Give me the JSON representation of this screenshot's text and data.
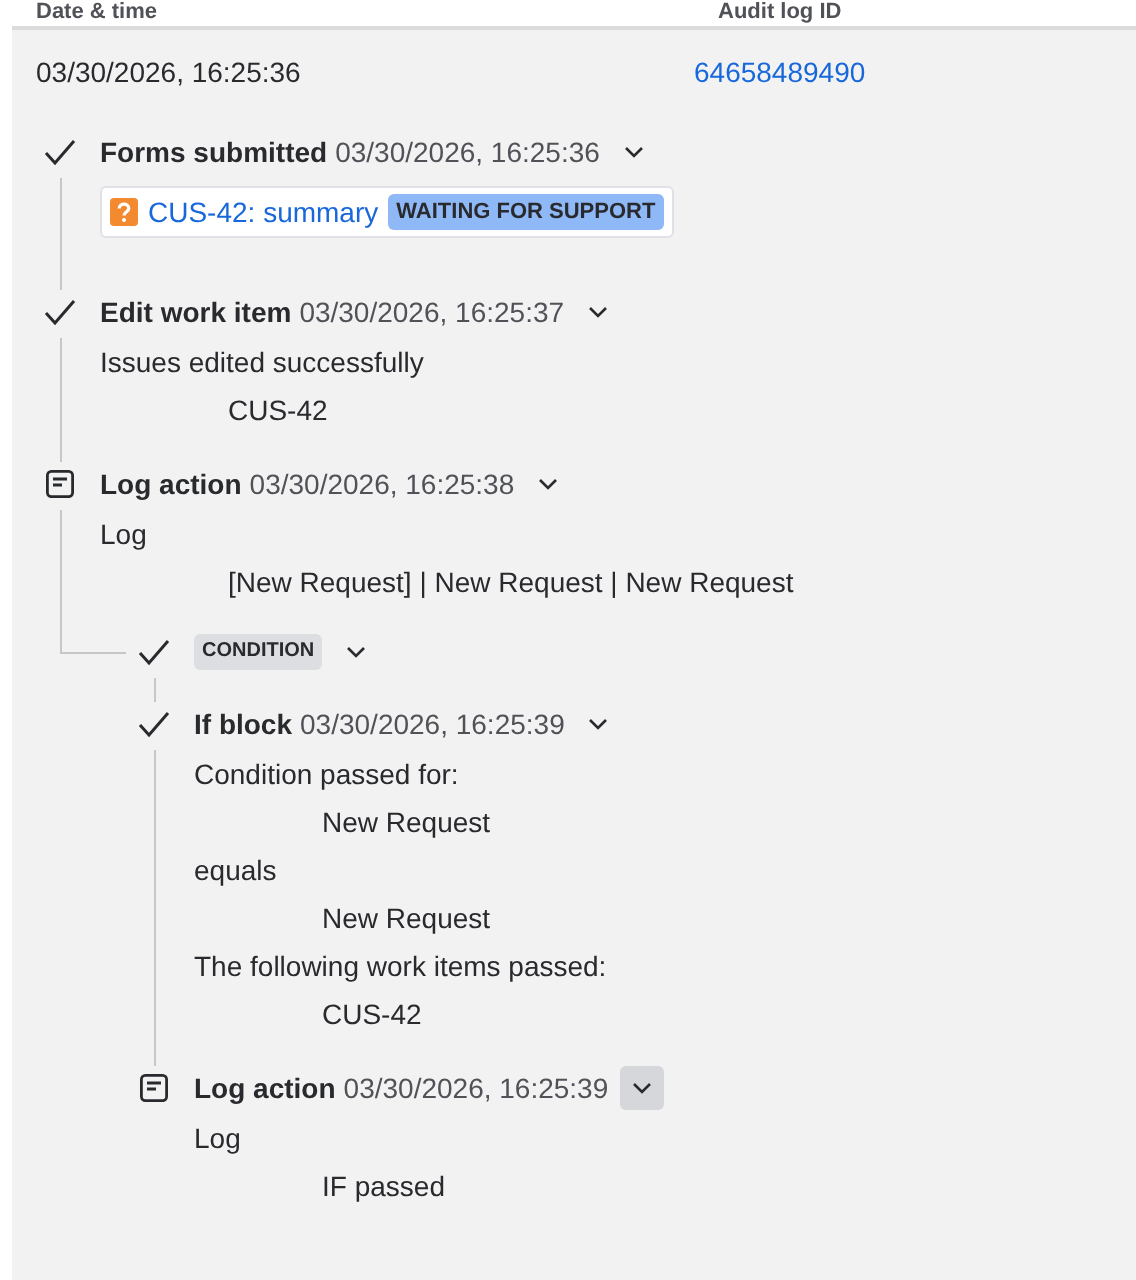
{
  "table": {
    "columns": [
      "Date & time",
      "Audit log ID"
    ],
    "row": {
      "date": "03/30/2026, 16:25:36",
      "audit_id": "64658489490"
    }
  },
  "steps": [
    {
      "kind": "check",
      "title": "Forms submitted",
      "time": "03/30/2026, 16:25:36",
      "chevron_highlighted": false,
      "issue": {
        "key": "CUS-42: summary",
        "status": "WAITING FOR SUPPORT"
      }
    },
    {
      "kind": "check",
      "title": "Edit work item",
      "time": "03/30/2026, 16:25:37",
      "chevron_highlighted": false,
      "lines": [
        {
          "kind": "label",
          "text": "Issues edited successfully"
        },
        {
          "kind": "value",
          "text": "CUS-42"
        }
      ]
    },
    {
      "kind": "log",
      "title": "Log action",
      "time": "03/30/2026, 16:25:38",
      "chevron_highlighted": false,
      "lines": [
        {
          "kind": "label",
          "text": "Log"
        },
        {
          "kind": "value",
          "text": "[New Request] | New Request | New Request"
        }
      ],
      "children": [
        {
          "kind": "condition",
          "badge": "CONDITION",
          "chevron_highlighted": false
        },
        {
          "kind": "check",
          "title": "If block",
          "time": "03/30/2026, 16:25:39",
          "chevron_highlighted": false,
          "lines": [
            {
              "kind": "label",
              "text": "Condition passed for:"
            },
            {
              "kind": "value",
              "text": "New Request"
            },
            {
              "kind": "label",
              "text": "equals"
            },
            {
              "kind": "value",
              "text": "New Request"
            },
            {
              "kind": "label",
              "text": "The following work items passed:"
            },
            {
              "kind": "value",
              "text": "CUS-42"
            }
          ]
        },
        {
          "kind": "log",
          "title": "Log action",
          "time": "03/30/2026, 16:25:39",
          "chevron_highlighted": true,
          "lines": [
            {
              "kind": "label",
              "text": "Log"
            },
            {
              "kind": "value",
              "text": "IF passed"
            }
          ]
        }
      ]
    }
  ]
}
